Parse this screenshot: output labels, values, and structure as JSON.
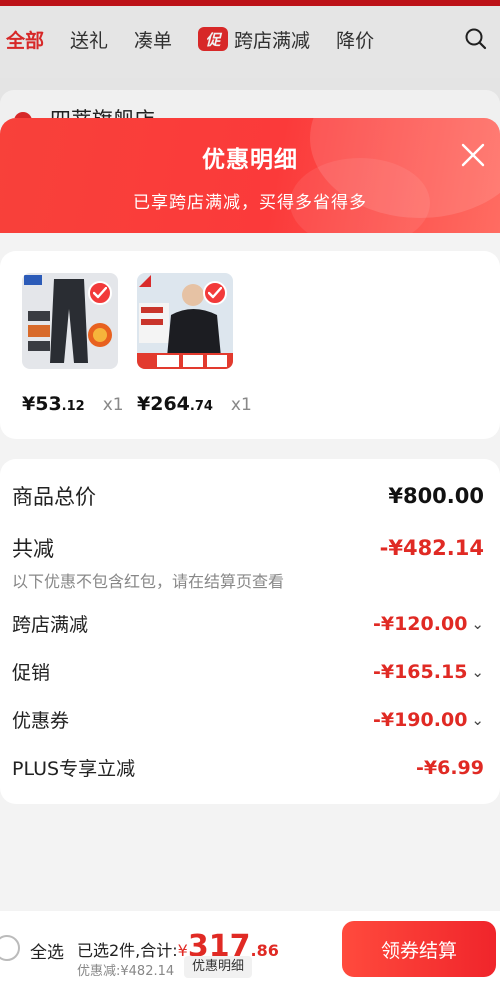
{
  "category_tabs": [
    {
      "label": "全部",
      "active": true
    },
    {
      "label": "送礼"
    },
    {
      "label": "凑单"
    },
    {
      "label": "跨店满减",
      "badge": "促"
    },
    {
      "label": "降价"
    }
  ],
  "store": {
    "name": "四蒂旗舰店"
  },
  "sheet": {
    "title": "优惠明细",
    "subtitle": "已享跨店满减，买得多省得多"
  },
  "products": [
    {
      "price_int": "¥53",
      "price_dec": ".12",
      "qty": "x1"
    },
    {
      "price_int": "¥264",
      "price_dec": ".74",
      "qty": "x1"
    }
  ],
  "breakdown": {
    "total_label": "商品总价",
    "total_value": "¥800.00",
    "reduction_label": "共减",
    "reduction_value": "-¥482.14",
    "note": "以下优惠不包含红包，请在结算页查看",
    "items": [
      {
        "label": "跨店满减",
        "value": "-¥120.00"
      },
      {
        "label": "促销",
        "value": "-¥165.15"
      },
      {
        "label": "优惠券",
        "value": "-¥190.00"
      },
      {
        "label": "PLUS专享立减",
        "value": "-¥6.99"
      }
    ]
  },
  "bottom_bar": {
    "select_all": "全选",
    "selected_text": "已选2件,合计:",
    "currency": "¥",
    "total_int": "317",
    "total_dec": ".86",
    "saved_text": "优惠减:¥482.14",
    "detail_button": "优惠明细",
    "checkout_button": "领券结算"
  },
  "colors": {
    "accent": "#e52b2b",
    "header_red": "#f8413a"
  }
}
